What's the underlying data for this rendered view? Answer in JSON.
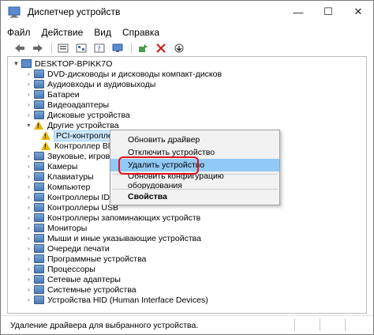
{
  "window": {
    "title": "Диспетчер устройств",
    "controls": {
      "minimize": "—",
      "maximize": "☐",
      "close": "✕"
    }
  },
  "menu": [
    "Файл",
    "Действие",
    "Вид",
    "Справка"
  ],
  "toolbar": {
    "icons": [
      "back-icon",
      "forward-icon",
      "properties-icon",
      "refresh-icon",
      "help-icon",
      "monitor-icon",
      "update-driver-icon",
      "uninstall-icon",
      "scan-hardware-icon"
    ]
  },
  "tree": {
    "root": "DESKTOP-BPIKK7O",
    "items": [
      "DVD-дисководы и дисководы компакт-дисков",
      "Аудиовходы и аудиовыходы",
      "Батареи",
      "Видеоадаптеры",
      "Дисковые устройства",
      "Другие устройства"
    ],
    "other_devices": [
      "PCI-контроллер Simple Communications",
      "Контроллер Blue"
    ],
    "items_after": [
      "Звуковые, игровые и",
      "Камеры",
      "Клавиатуры",
      "Компьютер",
      "Контроллеры IDE ATA",
      "Контроллеры USB",
      "Контроллеры запоминающих устройств",
      "Мониторы",
      "Мыши и иные указывающие устройства",
      "Очереди печати",
      "Программные устройства",
      "Процессоры",
      "Сетевые адаптеры",
      "Системные устройства",
      "Устройства HID (Human Interface Devices)"
    ]
  },
  "context_menu": {
    "update_driver": "Обновить драйвер",
    "disable_device": "Отключить устройство",
    "uninstall_device": "Удалить устройство",
    "scan_hardware": "Обновить конфигурацию оборудования",
    "properties": "Свойства"
  },
  "statusbar": {
    "text": "Удаление драйвера для выбранного устройства."
  },
  "colors": {
    "highlight": "#91c9f7",
    "annotation": "#e0141e",
    "warning": "#e6b400"
  }
}
